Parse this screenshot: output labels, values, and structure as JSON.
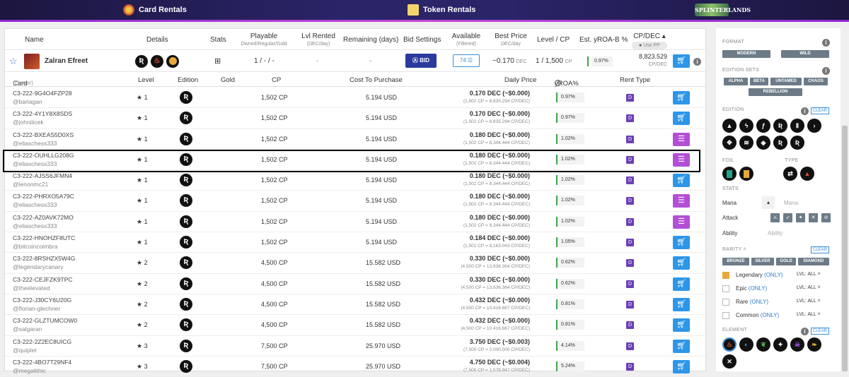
{
  "topnav": {
    "card_rentals": "Card Rentals",
    "token_rentals": "Token Rentals",
    "logo": "SPLINTERLANDS"
  },
  "header": {
    "name": "Name",
    "details": "Details",
    "stats": "Stats",
    "playable": "Playable",
    "playable_sub": "Owned/Regular/Gold",
    "lvl_rented": "Lvl Rented",
    "lvl_rented_sub": "(DEC/day)",
    "remaining": "Remaining (days)",
    "bid_settings": "Bid Settings",
    "available": "Available",
    "available_sub": "(Filtered)",
    "best_price": "Best Price",
    "best_price_sub": "DEC/day",
    "level_cp": "Level / CP",
    "est_yroa": "Est. yROA-B %",
    "cp_dec": "CP/DEC",
    "use_pp": "Use PP"
  },
  "summary": {
    "card_name": "Zalran Efreet",
    "playable": "1 / - / -",
    "lvl_rented": "-",
    "remaining": "-",
    "bid_label": "BID",
    "available": "74",
    "best_price": "~0.170",
    "best_price_unit": "DEC",
    "level_cp": "1 / 1,500",
    "level_cp_unit": "CP",
    "yroa": "0.97%",
    "cp_dec": "8,823.529",
    "cp_dec_unit": "CP/DEC"
  },
  "table": {
    "columns": [
      "Card",
      "(Owner)",
      "Level",
      "Edition",
      "Gold",
      "CP",
      "Cost To Purchase",
      "Daily Price",
      "yROA%",
      "Rent Type"
    ],
    "rows": [
      {
        "id": "C3-222-9G4O4FZP28",
        "owner": "@bariagan",
        "level": "1",
        "cp": "1,502 CP",
        "cost": "5.194 USD",
        "price": "0.170 DEC (~$0.000)",
        "price_sub": "(1,502 CP = 8,835.294 CP/DEC)",
        "yroa": "0.97%",
        "rent": "D",
        "btn": "cart"
      },
      {
        "id": "C3-222-4Y1Y8X8SDS",
        "owner": "@johniiicek",
        "level": "1",
        "cp": "1,502 CP",
        "cost": "5.194 USD",
        "price": "0.170 DEC (~$0.000)",
        "price_sub": "(1,502 CP = 8,835.294 CP/DEC)",
        "yroa": "0.97%",
        "rent": "D",
        "btn": "cart"
      },
      {
        "id": "C3-222-BXEAS5D0XS",
        "owner": "@eliaschess333",
        "level": "1",
        "cp": "1,502 CP",
        "cost": "5.194 USD",
        "price": "0.180 DEC (~$0.000)",
        "price_sub": "(1,502 CP = 8,344.444 CP/DEC)",
        "yroa": "1.02%",
        "rent": "D",
        "btn": "stack"
      },
      {
        "id": "C3-222-OUHLLG208G",
        "owner": "@eliaschess333",
        "level": "1",
        "cp": "1,502 CP",
        "cost": "5.194 USD",
        "price": "0.180 DEC (~$0.000)",
        "price_sub": "(1,502 CP = 8,344.444 CP/DEC)",
        "yroa": "1.02%",
        "rent": "D",
        "btn": "stack"
      },
      {
        "id": "C3-222-AJSS6JFMN4",
        "owner": "@lenonmc21",
        "level": "1",
        "cp": "1,502 CP",
        "cost": "5.194 USD",
        "price": "0.180 DEC (~$0.000)",
        "price_sub": "(1,502 CP = 8,344.444 CP/DEC)",
        "yroa": "1.02%",
        "rent": "D",
        "btn": "cart"
      },
      {
        "id": "C3-222-PHRXO5A79C",
        "owner": "@eliaschess333",
        "level": "1",
        "cp": "1,502 CP",
        "cost": "5.194 USD",
        "price": "0.180 DEC (~$0.000)",
        "price_sub": "(1,502 CP = 8,344.444 CP/DEC)",
        "yroa": "1.02%",
        "rent": "D",
        "btn": "stack"
      },
      {
        "id": "C3-222-AZ0AVK72MO",
        "owner": "@eliaschess333",
        "level": "1",
        "cp": "1,502 CP",
        "cost": "5.194 USD",
        "price": "0.180 DEC (~$0.000)",
        "price_sub": "(1,502 CP = 8,344.444 CP/DEC)",
        "yroa": "1.02%",
        "rent": "D",
        "btn": "stack"
      },
      {
        "id": "C3-222-HNOHZF8UTC",
        "owner": "@bitcoincoimbra",
        "level": "1",
        "cp": "1,502 CP",
        "cost": "5.194 USD",
        "price": "0.184 DEC (~$0.000)",
        "price_sub": "(1,502 CP = 8,163.043 CP/DEC)",
        "yroa": "1.05%",
        "rent": "D",
        "btn": "cart"
      },
      {
        "id": "C3-222-8RSHZX5W4G",
        "owner": "@legendarycanary",
        "level": "2",
        "cp": "4,500 CP",
        "cost": "15.582 USD",
        "price": "0.330 DEC (~$0.000)",
        "price_sub": "(4,500 CP = 13,636.364 CP/DEC)",
        "yroa": "0.62%",
        "rent": "D",
        "btn": "cart"
      },
      {
        "id": "C3-222-CEJFZK9TPC",
        "owner": "@theelevated",
        "level": "2",
        "cp": "4,500 CP",
        "cost": "15.582 USD",
        "price": "0.330 DEC (~$0.000)",
        "price_sub": "(4,500 CP = 13,636.364 CP/DEC)",
        "yroa": "0.62%",
        "rent": "D",
        "btn": "cart"
      },
      {
        "id": "C3-222-J30CY6U20G",
        "owner": "@florian-glechner",
        "level": "2",
        "cp": "4,500 CP",
        "cost": "15.582 USD",
        "price": "0.432 DEC (~$0.000)",
        "price_sub": "(4,500 CP = 10,416.667 CP/DEC)",
        "yroa": "0.81%",
        "rent": "D",
        "btn": "cart"
      },
      {
        "id": "C3-222-GLZTUMCOW0",
        "owner": "@salgaran",
        "level": "2",
        "cp": "4,500 CP",
        "cost": "15.582 USD",
        "price": "0.432 DEC (~$0.000)",
        "price_sub": "(4,500 CP = 10,416.667 CP/DEC)",
        "yroa": "0.81%",
        "rent": "D",
        "btn": "cart"
      },
      {
        "id": "C3-222-2Z2EC8UICG",
        "owner": "@quiplet",
        "level": "3",
        "cp": "7,500 CP",
        "cost": "25.970 USD",
        "price": "3.750 DEC (~$0.003)",
        "price_sub": "(7,500 CP = 2,000.000 CP/DEC)",
        "yroa": "4.14%",
        "rent": "D",
        "btn": "cart"
      },
      {
        "id": "C3-222-4BO7T29NF4",
        "owner": "@megalithic",
        "level": "3",
        "cp": "7,500 CP",
        "cost": "25.970 USD",
        "price": "4.750 DEC (~$0.004)",
        "price_sub": "(7,500 CP = 1,578.947 CP/DEC)",
        "yroa": "5.24%",
        "rent": "D",
        "btn": "cart"
      }
    ]
  },
  "sidebar": {
    "format": "FORMAT",
    "format_options": [
      "MODERN",
      "WILD"
    ],
    "edition_sets": "EDITION SETS",
    "edition_set_options": [
      "ALPHA",
      "BETA",
      "UNTAMED",
      "CHAOS",
      "REBELLION"
    ],
    "edition": "EDITION",
    "clear": "CLEAR",
    "foil": "FOIL",
    "type": "TYPE",
    "stats": "STATS",
    "mana": "Mana",
    "mana_placeholder": "Mana",
    "attack": "Attack",
    "ability": "Ability",
    "ability_placeholder": "Ability",
    "rarity": "RARITY",
    "rarity_options": [
      "BRONZE",
      "SILVER",
      "GOLD",
      "DIAMOND"
    ],
    "rarities": [
      {
        "label": "Legendary",
        "only": "(ONLY)",
        "lvl": "LVL: ALL",
        "checked": true
      },
      {
        "label": "Epic",
        "only": "(ONLY)",
        "lvl": "LVL: ALL",
        "checked": false
      },
      {
        "label": "Rare",
        "only": "(ONLY)",
        "lvl": "LVL: ALL",
        "checked": false
      },
      {
        "label": "Common",
        "only": "(ONLY)",
        "lvl": "LVL: ALL",
        "checked": false
      }
    ],
    "element": "ELEMENT"
  }
}
